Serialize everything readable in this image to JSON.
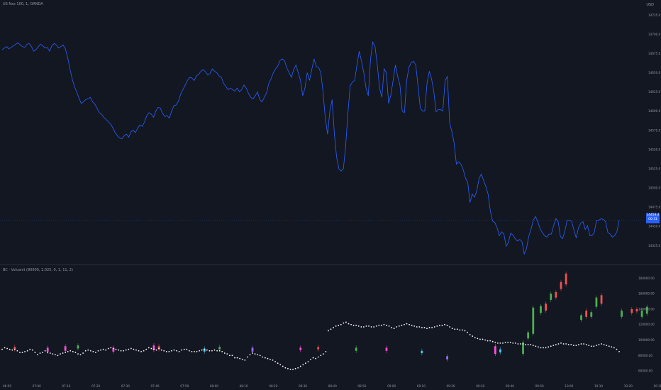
{
  "header": {
    "symbol_legend": "US Nas 100, 1, OANDA",
    "currency": "USD",
    "indicator_legend": "BC · Volcanit (80000, 1.025, 0, 1, 11, 2)"
  },
  "price_axis": {
    "labels": [
      "14725.0",
      "14700.0",
      "14675.0",
      "14650.0",
      "14625.0",
      "14600.0",
      "14575.0",
      "14550.0",
      "14525.0",
      "14500.0",
      "14475.0",
      "14450.0",
      "14425.0"
    ],
    "current_price": "14458.4",
    "current_countdown": "00:31"
  },
  "indicator_axis": {
    "labels": [
      "180000.00",
      "160000.00",
      "140000.00",
      "120000.00",
      "100000.00",
      "80000.00",
      "60000.00"
    ]
  },
  "time_axis": {
    "labels": [
      "06:50",
      "07:00",
      "07:10",
      "07:20",
      "07:30",
      "07:40",
      "07:50",
      "08:00",
      "08:10",
      "08:20",
      "08:30",
      "08:40",
      "08:50",
      "09:00",
      "09:10",
      "09:20",
      "09:30",
      "09:40",
      "09:50",
      "10:00",
      "10:10",
      "10:20",
      "10:30"
    ]
  },
  "colors": {
    "background": "#131722",
    "line": "#2962ff",
    "up": "#4caf50",
    "down": "#ef5350",
    "pink": "#ff4fd8",
    "cyan": "#4fc3f7",
    "violet": "#9c6bff",
    "dot": "#ffffff",
    "price_tag": "#2962ff"
  },
  "chart_data": [
    {
      "type": "line",
      "title": "US Nas 100, 1, OANDA",
      "ylim": [
        14405,
        14740
      ],
      "series": [
        {
          "name": "close",
          "values": [
            14680,
            14682,
            14684,
            14681,
            14683,
            14685,
            14687,
            14689,
            14686,
            14684,
            14683,
            14687,
            14688,
            14684,
            14678,
            14680,
            14684,
            14687,
            14685,
            14682,
            14683,
            14678,
            14685,
            14688,
            14686,
            14682,
            14684,
            14686,
            14681,
            14670,
            14655,
            14642,
            14632,
            14625,
            14617,
            14610,
            14612,
            14615,
            14616,
            14618,
            14612,
            14609,
            14604,
            14598,
            14596,
            14592,
            14589,
            14586,
            14583,
            14578,
            14572,
            14568,
            14565,
            14564,
            14568,
            14570,
            14566,
            14573,
            14575,
            14572,
            14578,
            14582,
            14580,
            14586,
            14594,
            14598,
            14596,
            14592,
            14600,
            14605,
            14604,
            14597,
            14593,
            14594,
            14591,
            14600,
            14607,
            14608,
            14613,
            14622,
            14628,
            14634,
            14640,
            14644,
            14643,
            14640,
            14646,
            14648,
            14652,
            14654,
            14651,
            14647,
            14649,
            14655,
            14652,
            14650,
            14646,
            14644,
            14636,
            14632,
            14628,
            14630,
            14628,
            14626,
            14630,
            14625,
            14628,
            14634,
            14630,
            14623,
            14618,
            14616,
            14620,
            14625,
            14615,
            14612,
            14618,
            14624,
            14636,
            14642,
            14650,
            14655,
            14659,
            14666,
            14668,
            14665,
            14656,
            14650,
            14644,
            14654,
            14660,
            14650,
            14640,
            14620,
            14630,
            14650,
            14640,
            14654,
            14668,
            14658,
            14657,
            14650,
            14625,
            14590,
            14570,
            14600,
            14615,
            14570,
            14540,
            14525,
            14522,
            14525,
            14555,
            14598,
            14633,
            14638,
            14640,
            14660,
            14678,
            14665,
            14650,
            14630,
            14620,
            14668,
            14690,
            14684,
            14660,
            14630,
            14618,
            14655,
            14650,
            14610,
            14621,
            14640,
            14660,
            14645,
            14634,
            14600,
            14598,
            14640,
            14657,
            14663,
            14665,
            14660,
            14633,
            14604,
            14600,
            14600,
            14636,
            14652,
            14642,
            14625,
            14599,
            14602,
            14602,
            14600,
            14640,
            14645,
            14585,
            14573,
            14558,
            14531,
            14534,
            14531,
            14524,
            14513,
            14507,
            14481,
            14492,
            14488,
            14496,
            14512,
            14518,
            14510,
            14502,
            14492,
            14470,
            14457,
            14455,
            14448,
            14438,
            14443,
            14440,
            14424,
            14429,
            14441,
            14439,
            14434,
            14431,
            14433,
            14430,
            14414,
            14421,
            14437,
            14446,
            14458,
            14463,
            14456,
            14447,
            14442,
            14438,
            14436,
            14440,
            14440,
            14451,
            14460,
            14456,
            14437,
            14434,
            14444,
            14458,
            14458,
            14456,
            14445,
            14435,
            14448,
            14454,
            14456,
            14446,
            14451,
            14438,
            14438,
            14442,
            14458,
            14458,
            14460,
            14459,
            14456,
            14442,
            14440,
            14436,
            14438,
            14443,
            14458
          ]
        }
      ]
    },
    {
      "type": "bar",
      "title": "BC · Volcanit (80000, 1.025, 0, 1, 11, 2)",
      "ylim": [
        50000,
        195000
      ],
      "candles": [
        {
          "i": 5,
          "open": 91000,
          "close": 88000,
          "color": "down"
        },
        {
          "i": 18,
          "open": 85000,
          "close": 90000,
          "color": "pink"
        },
        {
          "i": 25,
          "open": 92000,
          "close": 86000,
          "color": "pink"
        },
        {
          "i": 30,
          "open": 89000,
          "close": 93000,
          "color": "up"
        },
        {
          "i": 44,
          "open": 90000,
          "close": 85000,
          "color": "pink"
        },
        {
          "i": 60,
          "open": 93000,
          "close": 87000,
          "color": "pink"
        },
        {
          "i": 62,
          "open": 92000,
          "close": 88000,
          "color": "down"
        },
        {
          "i": 80,
          "open": 85000,
          "close": 89000,
          "color": "cyan"
        },
        {
          "i": 86,
          "open": 88000,
          "close": 91000,
          "color": "up"
        },
        {
          "i": 99,
          "open": 85000,
          "close": 90000,
          "color": "violet"
        },
        {
          "i": 118,
          "open": 90000,
          "close": 87000,
          "color": "pink"
        },
        {
          "i": 125,
          "open": 88000,
          "close": 91000,
          "color": "down"
        },
        {
          "i": 140,
          "open": 86000,
          "close": 90000,
          "color": "up"
        },
        {
          "i": 152,
          "open": 90000,
          "close": 86000,
          "color": "pink"
        },
        {
          "i": 166,
          "open": 83000,
          "close": 86000,
          "color": "cyan"
        },
        {
          "i": 176,
          "open": 75000,
          "close": 79000,
          "color": "violet"
        },
        {
          "i": 195,
          "open": 82000,
          "close": 92000,
          "color": "pink"
        },
        {
          "i": 197,
          "open": 84000,
          "close": 88000,
          "color": "cyan"
        },
        {
          "i": 206,
          "open": 97000,
          "close": 82000,
          "color": "up"
        },
        {
          "i": 208,
          "open": 102000,
          "close": 110000,
          "color": "up"
        },
        {
          "i": 210,
          "open": 108000,
          "close": 142000,
          "color": "up"
        },
        {
          "i": 213,
          "open": 135000,
          "close": 144000,
          "color": "up"
        },
        {
          "i": 215,
          "open": 147000,
          "close": 138000,
          "color": "down"
        },
        {
          "i": 217,
          "open": 152000,
          "close": 160000,
          "color": "up"
        },
        {
          "i": 219,
          "open": 162000,
          "close": 155000,
          "color": "down"
        },
        {
          "i": 221,
          "open": 166000,
          "close": 175000,
          "color": "down"
        },
        {
          "i": 223,
          "open": 186000,
          "close": 172000,
          "color": "down"
        },
        {
          "i": 229,
          "open": 126000,
          "close": 132000,
          "color": "up"
        },
        {
          "i": 231,
          "open": 138000,
          "close": 130000,
          "color": "down"
        },
        {
          "i": 233,
          "open": 130000,
          "close": 136000,
          "color": "up"
        },
        {
          "i": 235,
          "open": 143000,
          "close": 155000,
          "color": "up"
        },
        {
          "i": 237,
          "open": 147000,
          "close": 158000,
          "color": "down"
        },
        {
          "i": 245,
          "open": 130000,
          "close": 138000,
          "color": "up"
        },
        {
          "i": 249,
          "open": 140000,
          "close": 135000,
          "color": "down"
        },
        {
          "i": 251,
          "open": 137000,
          "close": 140000,
          "color": "down"
        },
        {
          "i": 253,
          "open": 138000,
          "close": 130000,
          "color": "up"
        },
        {
          "i": 255,
          "open": 134000,
          "close": 143000,
          "color": "up"
        },
        {
          "i": 262,
          "open": 124000,
          "close": 127000,
          "color": "up"
        },
        {
          "i": 266,
          "open": 129000,
          "close": 121000,
          "color": "down"
        },
        {
          "i": 270,
          "open": 130000,
          "close": 136000,
          "color": "up"
        },
        {
          "i": 275,
          "open": 123000,
          "close": 129000,
          "color": "down"
        },
        {
          "i": 278,
          "open": 138000,
          "close": 145000,
          "color": "down"
        },
        {
          "i": 280,
          "open": 146000,
          "close": 153000,
          "color": "up"
        },
        {
          "i": 283,
          "open": 128000,
          "close": 135000,
          "color": "up"
        },
        {
          "i": 287,
          "open": 133000,
          "close": 125000,
          "color": "down"
        },
        {
          "i": 289,
          "open": 132000,
          "close": 140000,
          "color": "down"
        },
        {
          "i": 292,
          "open": 131000,
          "close": 136000,
          "color": "up"
        },
        {
          "i": 295,
          "open": 119000,
          "close": 123000,
          "color": "pink"
        },
        {
          "i": 300,
          "open": 117000,
          "close": 112000,
          "color": "cyan"
        },
        {
          "i": 305,
          "open": 110000,
          "close": 114000,
          "color": "up"
        },
        {
          "i": 308,
          "open": 112000,
          "close": 106000,
          "color": "up"
        },
        {
          "i": 315,
          "open": 108000,
          "close": 103000,
          "color": "pink"
        },
        {
          "i": 325,
          "open": 99000,
          "close": 102000,
          "color": "cyan"
        },
        {
          "i": 337,
          "open": 96000,
          "close": 100000,
          "color": "up"
        },
        {
          "i": 342,
          "open": 97000,
          "close": 102000,
          "color": "down"
        },
        {
          "i": 350,
          "open": 99000,
          "close": 103000,
          "color": "up"
        },
        {
          "i": 354,
          "open": 102000,
          "close": 96000,
          "color": "down"
        },
        {
          "i": 358,
          "open": 95000,
          "close": 98000,
          "color": "pink"
        },
        {
          "i": 363,
          "open": 94000,
          "close": 98000,
          "color": "cyan"
        }
      ],
      "dots": [
        88000,
        90000,
        89000,
        88000,
        87000,
        88000,
        86000,
        84000,
        84000,
        85000,
        86000,
        88000,
        87000,
        84000,
        81000,
        83000,
        84000,
        86000,
        84000,
        83000,
        82000,
        81000,
        80000,
        82000,
        83000,
        84000,
        85000,
        86000,
        85000,
        84000,
        82000,
        81000,
        83000,
        86000,
        87000,
        86000,
        85000,
        84000,
        86000,
        87000,
        88000,
        87000,
        89000,
        90000,
        89000,
        88000,
        87000,
        86000,
        86000,
        87000,
        88000,
        89000,
        88000,
        87000,
        86000,
        85000,
        86000,
        88000,
        90000,
        89000,
        88000,
        87000,
        89000,
        87000,
        86000,
        85000,
        85000,
        86000,
        87000,
        86000,
        85000,
        87000,
        88000,
        88000,
        86000,
        85000,
        85000,
        85000,
        86000,
        87000,
        88000,
        87000,
        86000,
        86000,
        87000,
        86000,
        86000,
        85000,
        83000,
        82000,
        80000,
        80000,
        77000,
        77000,
        76000,
        75000,
        74000,
        78000,
        81000,
        83000,
        82000,
        81000,
        80000,
        78000,
        77000,
        76000,
        75000,
        74000,
        72000,
        70000,
        68000,
        66000,
        64000,
        63000,
        62000,
        62000,
        63000,
        64000,
        66000,
        68000,
        70000,
        72000,
        75000,
        77000,
        76000,
        78000,
        80000,
        82000,
        85000,
        112000,
        114000,
        116000,
        118000,
        119000,
        120000,
        122000,
        123000,
        121000,
        120000,
        119000,
        119000,
        118000,
        117000,
        117000,
        118000,
        118000,
        117000,
        117000,
        118000,
        119000,
        119000,
        120000,
        119000,
        118000,
        116000,
        115000,
        117000,
        118000,
        119000,
        120000,
        121000,
        120000,
        119000,
        118000,
        117000,
        117000,
        116000,
        116000,
        115000,
        116000,
        116000,
        117000,
        118000,
        119000,
        119000,
        120000,
        119000,
        117000,
        115000,
        114000,
        114000,
        113000,
        113000,
        112000,
        110000,
        107000,
        105000,
        103000,
        102000,
        101000,
        101000,
        100000,
        99000,
        99000,
        98000,
        97000,
        96000,
        96000,
        96000,
        97000,
        97000,
        97000,
        96000,
        96000,
        95000,
        95000,
        95000,
        94000,
        94000,
        94000,
        93000,
        92000,
        91000,
        90000,
        90000,
        90000,
        91000,
        92000,
        93000,
        94000,
        95000,
        96000,
        95000,
        95000,
        94000,
        94000,
        93000,
        93000,
        94000,
        95000,
        95000,
        94000,
        93000,
        92000,
        92000,
        93000,
        94000,
        95000,
        94000,
        93000,
        92000,
        91000,
        90000,
        88000,
        85000
      ]
    }
  ]
}
